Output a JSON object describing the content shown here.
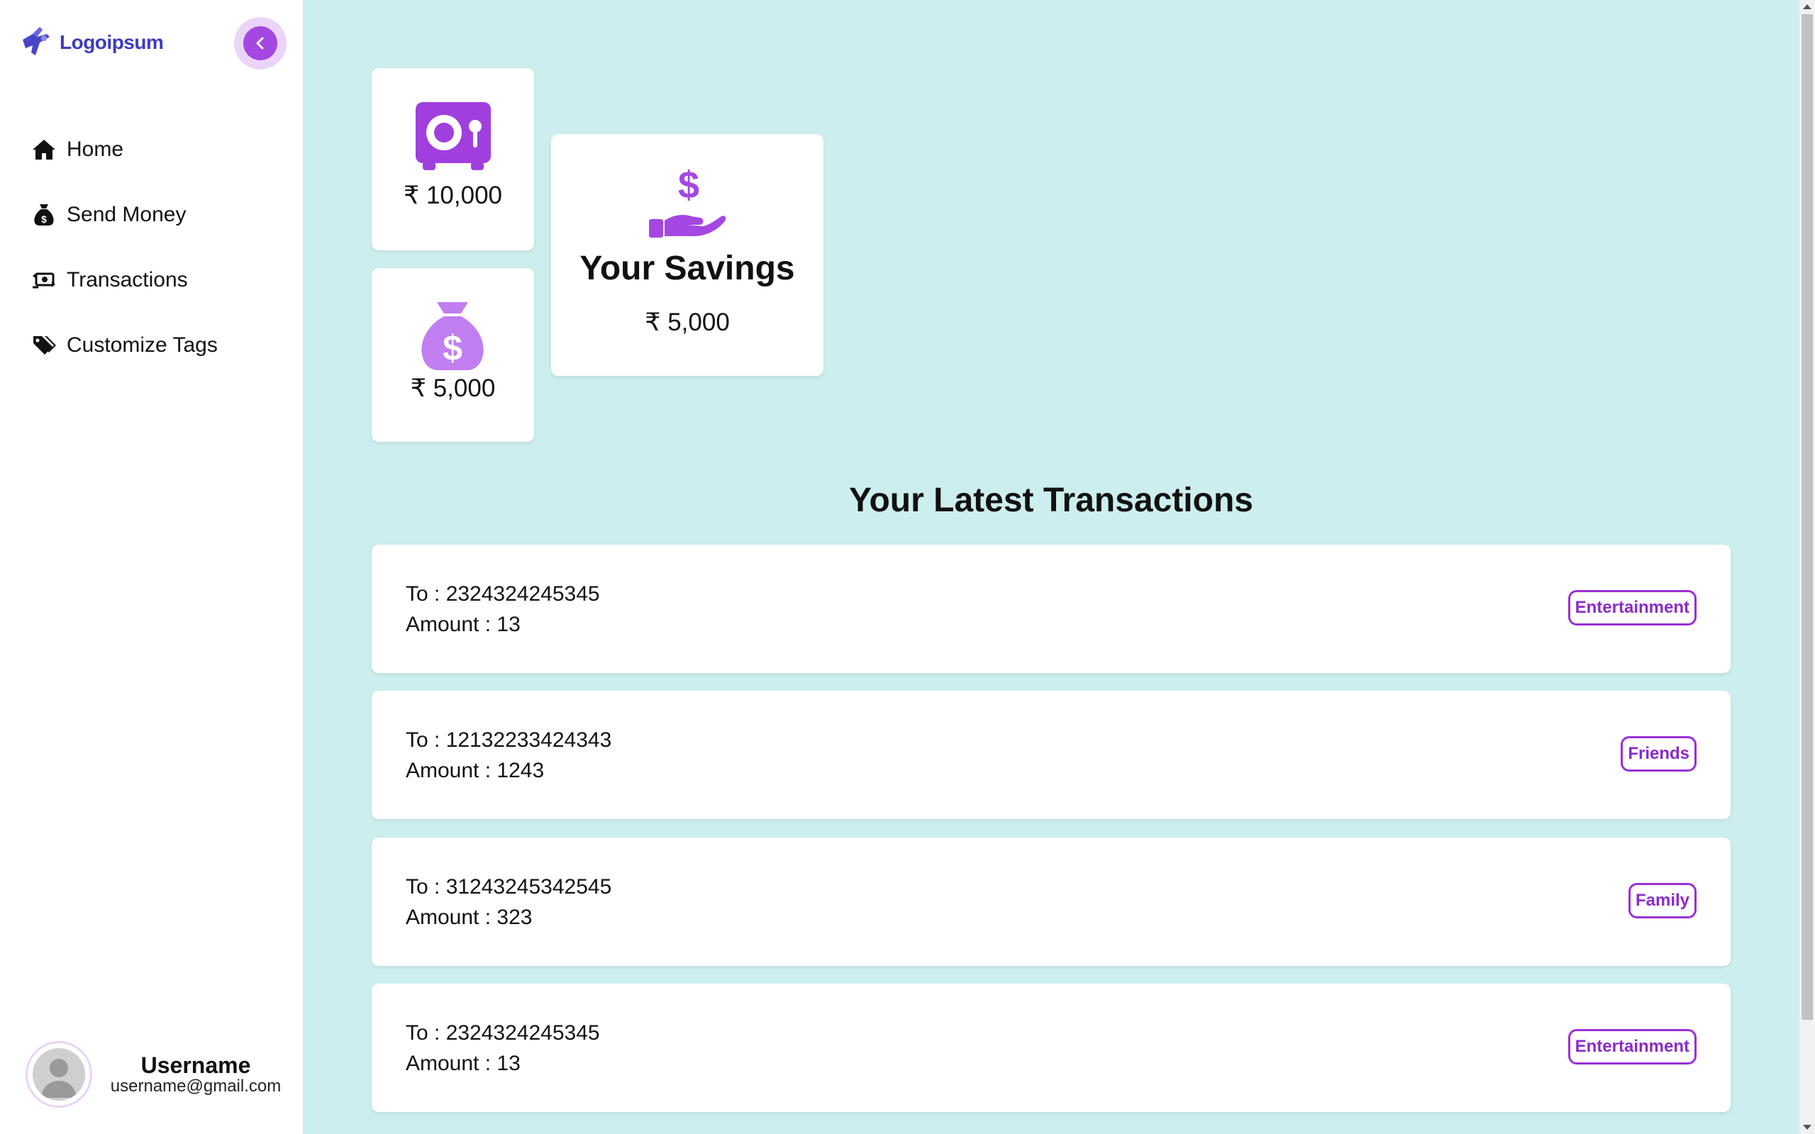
{
  "brand": {
    "name": "Logoipsum",
    "logo_icon": "logo-icon",
    "color": "#3d3bbf"
  },
  "sidebar": {
    "collapse_icon": "chevron-left-icon",
    "items": [
      {
        "label": "Home",
        "icon": "home-icon"
      },
      {
        "label": "Send Money",
        "icon": "money-bag-icon"
      },
      {
        "label": "Transactions",
        "icon": "money-exchange-icon"
      },
      {
        "label": "Customize Tags",
        "icon": "tags-icon"
      }
    ]
  },
  "user": {
    "name": "Username",
    "email": "username@gmail.com",
    "avatar_icon": "avatar-icon"
  },
  "cards": {
    "vault": {
      "icon": "vault-icon",
      "amount": "₹ 10,000"
    },
    "bag": {
      "icon": "money-bag-icon",
      "amount": "₹ 5,000"
    },
    "savings": {
      "icon": "hand-dollar-icon",
      "title": "Your Savings",
      "amount": "₹ 5,000"
    }
  },
  "transactions": {
    "heading": "Your Latest Transactions",
    "items": [
      {
        "to": "To : 2324324245345",
        "amount": "Amount : 13",
        "tag": "Entertainment"
      },
      {
        "to": "To : 12132233424343",
        "amount": "Amount : 1243",
        "tag": "Friends"
      },
      {
        "to": "To : 31243245342545",
        "amount": "Amount : 323",
        "tag": "Family"
      },
      {
        "to": "To : 2324324245345",
        "amount": "Amount : 13",
        "tag": "Entertainment"
      }
    ]
  },
  "colors": {
    "background": "#cdeeee",
    "accent": "#a447e3",
    "accent_light": "#ead5f9",
    "tag_border": "#9b2fd6"
  }
}
